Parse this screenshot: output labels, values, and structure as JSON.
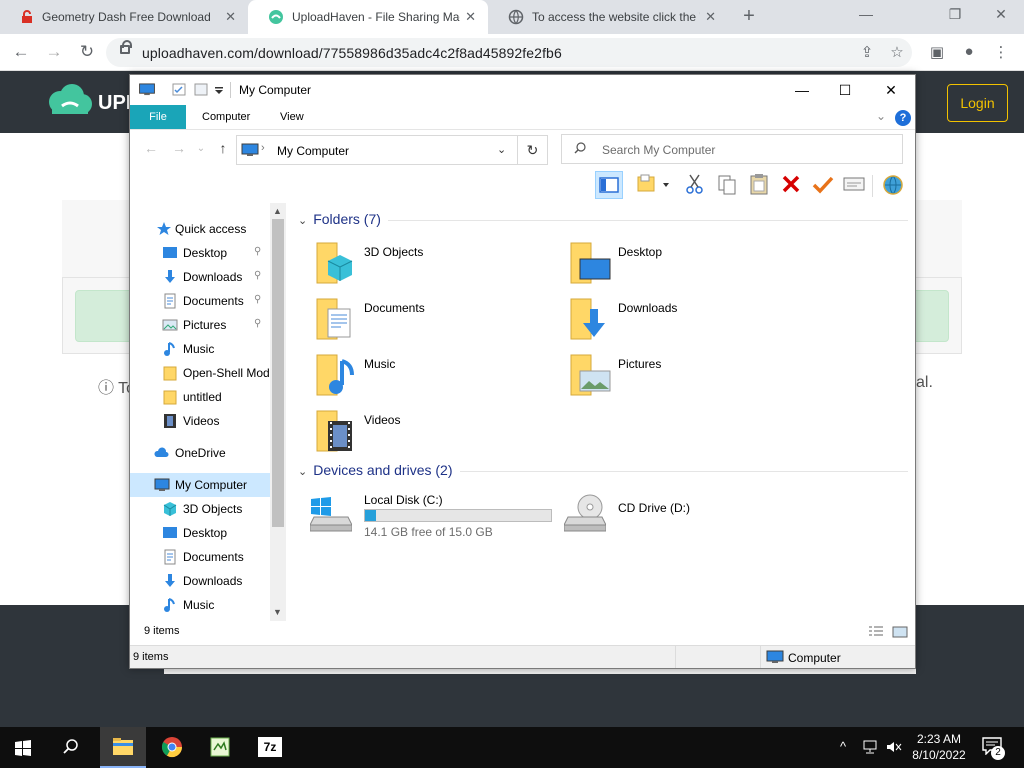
{
  "browser": {
    "tabs": [
      {
        "title": "Geometry Dash Free Download (",
        "close": "✕"
      },
      {
        "title": "UploadHaven - File Sharing Mad",
        "close": "✕"
      },
      {
        "title": "To access the website click the \"A",
        "close": "✕"
      }
    ],
    "new_tab": "+",
    "window_controls": {
      "minimize": "—",
      "restore": "❐",
      "close": "✕"
    },
    "nav": {
      "back": "←",
      "forward": "→",
      "reload": "↻"
    },
    "url": "uploadhaven.com/download/77558986d35adc4c2f8ad45892fe2fb6",
    "toolbar_icons": {
      "share": "⇪",
      "bookmark": "☆",
      "sidebar": "▣",
      "profile": "●",
      "menu": "⋮"
    }
  },
  "page": {
    "logo_text": "UPL",
    "login_label": "Login",
    "note_left": "ⓘ To",
    "note_right": "al."
  },
  "explorer": {
    "title": "My Computer",
    "window_controls": {
      "minimize": "—",
      "maximize": "☐",
      "close": "✕"
    },
    "ribbon_tabs": [
      "File",
      "Computer",
      "View"
    ],
    "help": "?",
    "ribbon_chevron": "⌄",
    "address": {
      "back": "←",
      "forward": "→",
      "recent": "⌄",
      "up": "↑",
      "separator": "›",
      "path": "My Computer",
      "dropdown": "⌄",
      "refresh": "↻"
    },
    "search_placeholder": "Search My Computer",
    "nav_pane": {
      "quick_access": "Quick access",
      "quick_items": [
        "Desktop",
        "Downloads",
        "Documents",
        "Pictures",
        "Music",
        "Open-Shell Mod",
        "untitled",
        "Videos"
      ],
      "pin": "📌",
      "onedrive": "OneDrive",
      "my_computer": "My Computer",
      "pc_items": [
        "3D Objects",
        "Desktop",
        "Documents",
        "Downloads",
        "Music"
      ],
      "scroll_up": "▲",
      "scroll_down": "▼"
    },
    "groups": {
      "folders_header": "Folders (7)",
      "devices_header": "Devices and drives (2)",
      "caret": "⌄"
    },
    "folders": [
      "3D Objects",
      "Desktop",
      "Documents",
      "Downloads",
      "Music",
      "Pictures",
      "Videos"
    ],
    "drives": [
      {
        "name": "Local Disk (C:)",
        "free_text": "14.1 GB free of 15.0 GB",
        "used_fraction": 0.06
      },
      {
        "name": "CD Drive (D:)"
      }
    ],
    "status_top": "9 items",
    "status_bottom": "9 items",
    "status_location": "Computer"
  },
  "taskbar": {
    "time": "2:23 AM",
    "date": "8/10/2022",
    "tray_chevron": "^",
    "notifications": "2"
  },
  "colors": {
    "ribbon_file": "#1aa5b8",
    "selection": "#cce8ff",
    "folder": "#ffd767",
    "drive_fill": "#26a0da",
    "page_dark": "#2f353b",
    "login_yellow": "#f2c200"
  }
}
